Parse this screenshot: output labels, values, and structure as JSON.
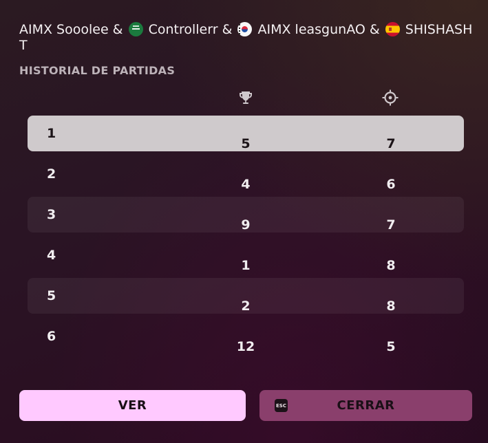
{
  "header": {
    "team_part1": "AIMX Sooolee &",
    "team_part2": "Controllerr &",
    "team_part3": "AIMX leasgunAO &",
    "team_part4": "SHISHASHT"
  },
  "flags": [
    "saudi-arabia-flag",
    "south-korea-flag",
    "spain-flag"
  ],
  "section_title": "HISTORIAL DE PARTIDAS",
  "columns": {
    "wins_icon": "trophy-icon",
    "kills_icon": "crosshair-icon"
  },
  "matches": [
    {
      "round": "1",
      "wins": "5",
      "kills": "7"
    },
    {
      "round": "2",
      "wins": "4",
      "kills": "6"
    },
    {
      "round": "3",
      "wins": "9",
      "kills": "7"
    },
    {
      "round": "4",
      "wins": "1",
      "kills": "8"
    },
    {
      "round": "5",
      "wins": "2",
      "kills": "8"
    },
    {
      "round": "6",
      "wins": "12",
      "kills": "5"
    }
  ],
  "selected_row": 0,
  "buttons": {
    "view_label": "VER",
    "close_label": "CERRAR",
    "esc_key_label": "ESC"
  },
  "colors": {
    "view_button": "#ffc9ff",
    "close_button": "#8a3f6c",
    "selected_row": "#cfcacc"
  }
}
